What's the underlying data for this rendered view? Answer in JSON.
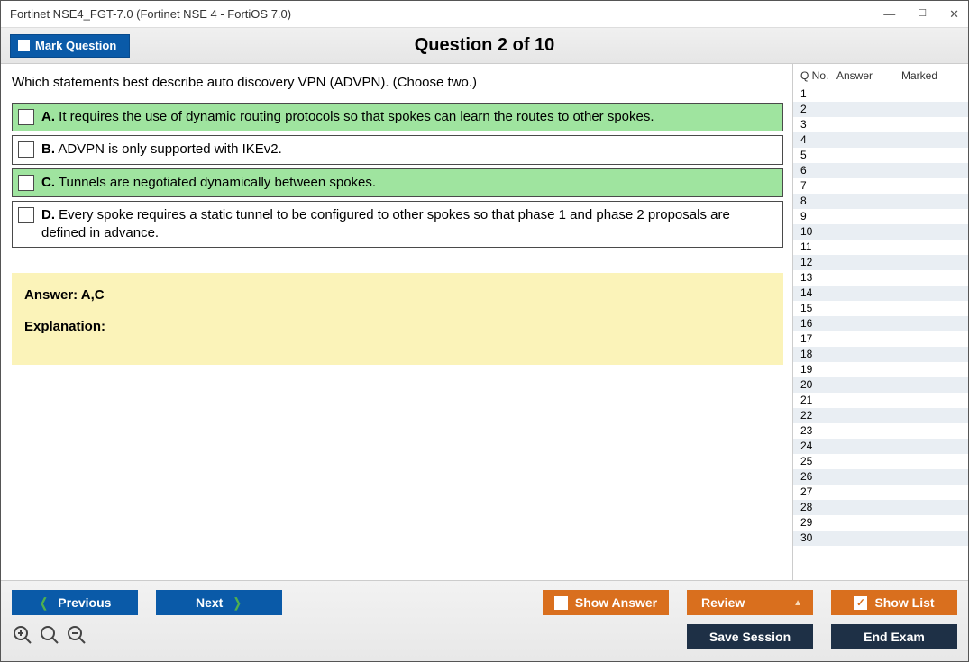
{
  "window": {
    "title": "Fortinet NSE4_FGT-7.0 (Fortinet NSE 4 - FortiOS 7.0)"
  },
  "header": {
    "mark_label": "Mark Question",
    "counter": "Question 2 of 10"
  },
  "question": {
    "text": "Which statements best describe auto discovery VPN (ADVPN). (Choose two.)",
    "options": [
      {
        "letter": "A.",
        "text": "It requires the use of dynamic routing protocols so that spokes can learn the routes to other spokes.",
        "highlight": true
      },
      {
        "letter": "B.",
        "text": "ADVPN is only supported with IKEv2.",
        "highlight": false
      },
      {
        "letter": "C.",
        "text": "Tunnels are negotiated dynamically between spokes.",
        "highlight": true
      },
      {
        "letter": "D.",
        "text": "Every spoke requires a static tunnel to be configured to other spokes so that phase 1 and phase 2 proposals are defined in advance.",
        "highlight": false
      }
    ]
  },
  "answer_panel": {
    "answer_label": "Answer: A,C",
    "explanation_label": "Explanation:"
  },
  "sidebar": {
    "cols": {
      "qno": "Q No.",
      "answer": "Answer",
      "marked": "Marked"
    },
    "rows": [
      1,
      2,
      3,
      4,
      5,
      6,
      7,
      8,
      9,
      10,
      11,
      12,
      13,
      14,
      15,
      16,
      17,
      18,
      19,
      20,
      21,
      22,
      23,
      24,
      25,
      26,
      27,
      28,
      29,
      30
    ]
  },
  "buttons": {
    "previous": "Previous",
    "next": "Next",
    "show_answer": "Show Answer",
    "review": "Review",
    "show_list": "Show List",
    "save_session": "Save Session",
    "end_exam": "End Exam"
  }
}
